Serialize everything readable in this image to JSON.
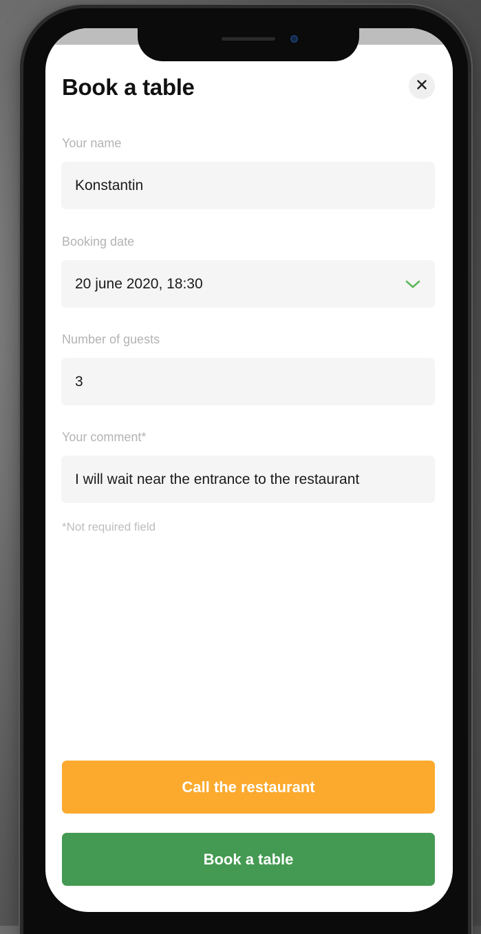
{
  "form": {
    "title": "Book a table",
    "name_label": "Your name",
    "name_value": "Konstantin",
    "date_label": "Booking date",
    "date_value": "20 june 2020, 18:30",
    "guests_label": "Number of guests",
    "guests_value": "3",
    "comment_label": "Your comment*",
    "comment_value": "I will wait near the entrance to the restaurant",
    "footnote": "*Not required field"
  },
  "actions": {
    "call_label": "Call the restaurant",
    "book_label": "Book a table"
  },
  "icons": {
    "close": "close-icon",
    "dropdown": "chevron-down-icon"
  },
  "colors": {
    "call_button": "#fbaa2e",
    "book_button": "#449a52",
    "chevron": "#5cb85c",
    "field_background": "#f5f5f5"
  }
}
